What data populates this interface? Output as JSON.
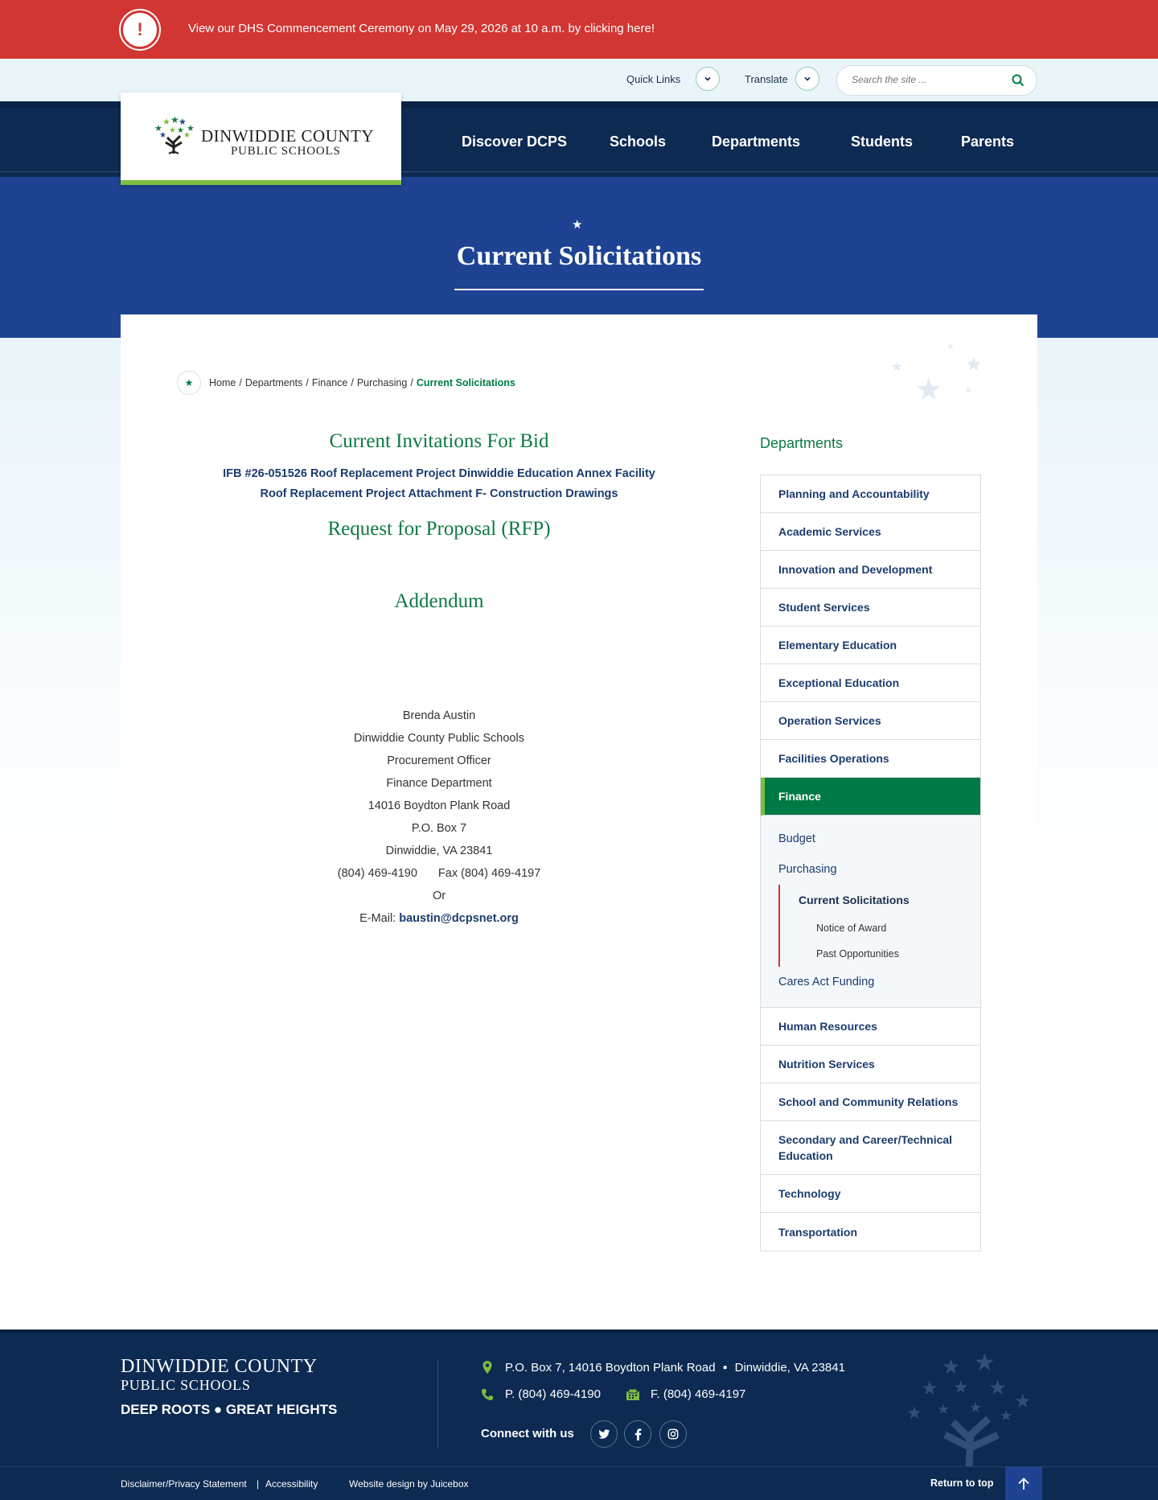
{
  "alert": {
    "text": "View our DHS Commencement Ceremony on May 29, 2026 at 10 a.m. by clicking here!",
    "icon": "exclamation-icon"
  },
  "utility": {
    "quick_links": "Quick Links",
    "translate": "Translate",
    "search_placeholder": "Search the site ..."
  },
  "logo": {
    "line1": "DINWIDDIE COUNTY",
    "line2": "PUBLIC SCHOOLS"
  },
  "nav": [
    "Discover DCPS",
    "Schools",
    "Departments",
    "Students",
    "Parents"
  ],
  "banner": {
    "title": "Current Solicitations"
  },
  "breadcrumb": {
    "items": [
      "Home",
      "Departments",
      "Finance",
      "Purchasing"
    ],
    "current": "Current Solicitations"
  },
  "main": {
    "heading_bid": "Current Invitations For Bid",
    "links": [
      "IFB #26-051526 Roof Replacement Project Dinwiddie Education Annex Facility",
      "Roof Replacement Project Attachment F- Construction Drawings"
    ],
    "heading_rfp": "Request for Proposal (RFP)",
    "heading_addendum": "Addendum",
    "contact": [
      "Brenda Austin",
      "Dinwiddie County Public Schools",
      "Procurement Officer",
      "Finance Department",
      "14016 Boydton Plank Road",
      "P.O. Box 7",
      "Dinwiddie, VA 23841"
    ],
    "phone": "(804) 469-4190",
    "fax": "Fax (804) 469-4197",
    "or": "Or",
    "email_label": "E-Mail:",
    "email": "baustin@dcpsnet.org"
  },
  "sidebar": {
    "title": "Departments",
    "items_top": [
      "Planning and Accountability",
      "Academic Services",
      "Innovation and Development",
      "Student Services",
      "Elementary Education",
      "Exceptional Education",
      "Operation Services",
      "Facilities Operations"
    ],
    "active": "Finance",
    "sub": {
      "budget": "Budget",
      "purchasing": "Purchasing",
      "current": "Current Solicitations",
      "notice": "Notice of Award",
      "past": "Past Opportunities",
      "cares": "Cares Act Funding"
    },
    "items_bottom": [
      "Human Resources",
      "Nutrition Services",
      "School and Community Relations",
      "Secondary and Career/Technical Education",
      "Technology",
      "Transportation"
    ]
  },
  "footer": {
    "name1": "DINWIDDIE COUNTY",
    "name2": "PUBLIC SCHOOLS",
    "tagline": "DEEP ROOTS ● GREAT HEIGHTS",
    "address": "P.O. Box 7, 14016 Boydton Plank Road",
    "city": "Dinwiddie, VA 23841",
    "phone": "P. (804) 469-4190",
    "fax": "F. (804) 469-4197",
    "connect": "Connect with us",
    "social": [
      "twitter-icon",
      "facebook-icon",
      "instagram-icon"
    ]
  },
  "bottom": {
    "disclaimer": "Disclaimer/Privacy Statement",
    "accessibility": "Accessibility",
    "design": "Website design by Juicebox",
    "return": "Return to top"
  },
  "colors": {
    "alert_red": "#d13632",
    "navy": "#0c2a52",
    "banner_blue": "#1f4393",
    "green": "#007a45",
    "lime": "#7dbd3f"
  }
}
